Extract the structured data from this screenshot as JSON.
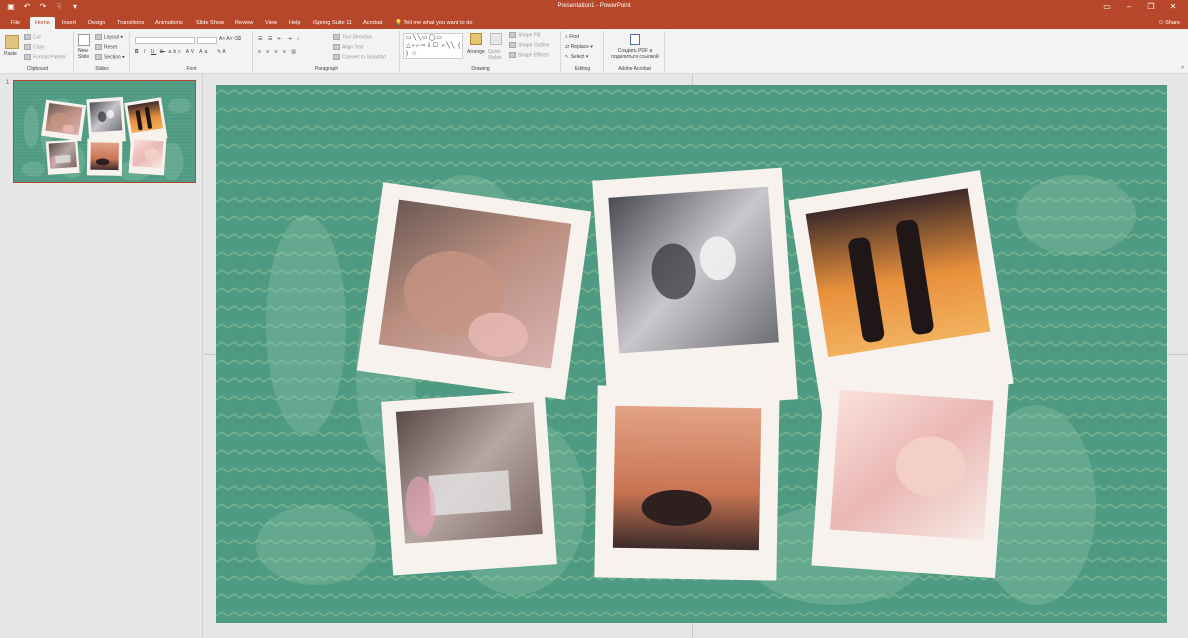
{
  "app": {
    "window_title": "Presentation1 - PowerPoint",
    "share_label": "Share"
  },
  "tabs": [
    "File",
    "Home",
    "Insert",
    "Design",
    "Transitions",
    "Animations",
    "Slide Show",
    "Review",
    "View",
    "Help",
    "iSpring Suite 11",
    "Acrobat",
    "Tell me what you want to do"
  ],
  "active_tab": "Home",
  "ribbon": {
    "clipboard": {
      "label": "Clipboard",
      "paste": "Paste",
      "cut": "Cut",
      "copy": "Copy",
      "format_painter": "Format Painter"
    },
    "slides": {
      "label": "Slides",
      "new_slide": "New Slide",
      "layout": "Layout",
      "reset": "Reset",
      "section": "Section"
    },
    "font": {
      "label": "Font",
      "bold": "B",
      "italic": "I",
      "underline": "U",
      "strike": "S",
      "abc": "abc",
      "av": "AV",
      "aa": "Aa",
      "font_color": "A"
    },
    "paragraph": {
      "label": "Paragraph",
      "text_direction": "Text Direction",
      "align_text": "Align Text",
      "convert_smartart": "Convert to SmartArt"
    },
    "drawing": {
      "label": "Drawing",
      "shapes_glyphs": "▭╲╲▭◯▭ △⌐⌐⇨⇩☐ ⌐╲╲ { } ☆",
      "arrange": "Arrange",
      "quick_styles": "Quick Styles",
      "shape_fill": "Shape Fill",
      "shape_outline": "Shape Outline",
      "shape_effects": "Shape Effects"
    },
    "editing": {
      "label": "Editing",
      "find": "Find",
      "replace": "Replace",
      "select": "Select"
    },
    "acrobat": {
      "label": "Adobe Acrobat",
      "create_pdf": "Создать PDF и поделиться ссылкой"
    }
  },
  "thumbnail": {
    "slide_number": "1"
  },
  "colors": {
    "accent": "#b7472a",
    "slide_bg": "#4e9a82",
    "zigzag": "#73b292",
    "polaroid": "#f8f2ee"
  },
  "photos": [
    "baby-face-photo",
    "wedding-dance-photo",
    "couple-sunset-photo",
    "wedding-couple-bench-photo",
    "sunset-silhouette-photo",
    "sleeping-baby-photo"
  ]
}
